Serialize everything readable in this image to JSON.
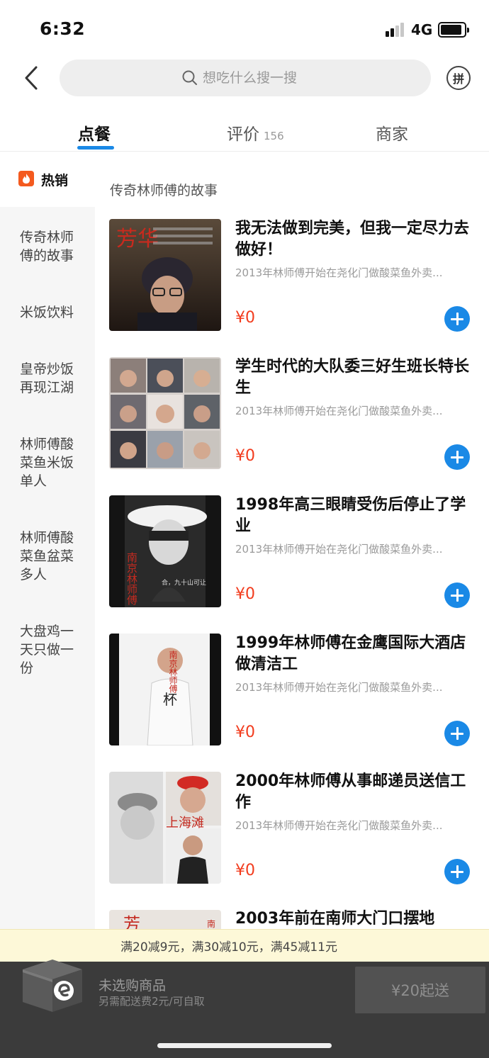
{
  "status_bar": {
    "time": "6:32",
    "network": "4G"
  },
  "header": {
    "search_placeholder": "想吃什么搜一搜",
    "group_icon_label": "拼"
  },
  "tabs": [
    {
      "label": "点餐",
      "count": ""
    },
    {
      "label": "评价",
      "count": "156"
    },
    {
      "label": "商家",
      "count": ""
    }
  ],
  "sidebar": {
    "hot_label": "热销",
    "items": [
      {
        "label": "传奇林师傅的故事"
      },
      {
        "label": "米饭饮料"
      },
      {
        "label": "皇帝炒饭再现江湖"
      },
      {
        "label": "林师傅酸菜鱼米饭单人"
      },
      {
        "label": "林师傅酸菜鱼盆菜多人"
      },
      {
        "label": "大盘鸡一天只做一份"
      }
    ]
  },
  "section_title": "传奇林师傅的故事",
  "items": [
    {
      "title": "我无法做到完美，但我一定尽力去做好！",
      "desc": "2013年林师傅开始在尧化门做酸菜鱼外卖...",
      "price": "¥0"
    },
    {
      "title": "学生时代的大队委三好生班长特长生",
      "desc": "2013年林师傅开始在尧化门做酸菜鱼外卖...",
      "price": "¥0"
    },
    {
      "title": "1998年高三眼睛受伤后停止了学业",
      "desc": "2013年林师傅开始在尧化门做酸菜鱼外卖...",
      "price": "¥0"
    },
    {
      "title": "1999年林师傅在金鹰国际大酒店做清洁工",
      "desc": "2013年林师傅开始在尧化门做酸菜鱼外卖...",
      "price": "¥0"
    },
    {
      "title": "2000年林师傅从事邮递员送信工作",
      "desc": "2013年林师傅开始在尧化门做酸菜鱼外卖...",
      "price": "¥0"
    },
    {
      "title": "2003年前在南师大门口摆地",
      "desc": "",
      "price": ""
    }
  ],
  "images": {
    "img1": {
      "overlay_top": "芳华",
      "caption": ""
    },
    "img3": {
      "vertical_text": "南京林师傅",
      "caption": "合，九十山可让"
    },
    "img4": {
      "overlay_text": "南京林师傅",
      "shirt": "杯"
    },
    "img5": {
      "overlay_text": "上海滩"
    },
    "img6": {
      "overlay_top": "芳",
      "side_text": "南"
    }
  },
  "promo": {
    "text": "满20减9元，满30减10元，满45减11元"
  },
  "cart": {
    "main_text": "未选购商品",
    "sub_text": "另需配送费2元/可自取",
    "checkout_label": "¥20起送"
  },
  "colors": {
    "accent": "#1a89e6",
    "price": "#f23c1e",
    "hot": "#f45a1f",
    "promo_bg": "#fdf8d8",
    "cart_bg": "#3b3b3b"
  }
}
